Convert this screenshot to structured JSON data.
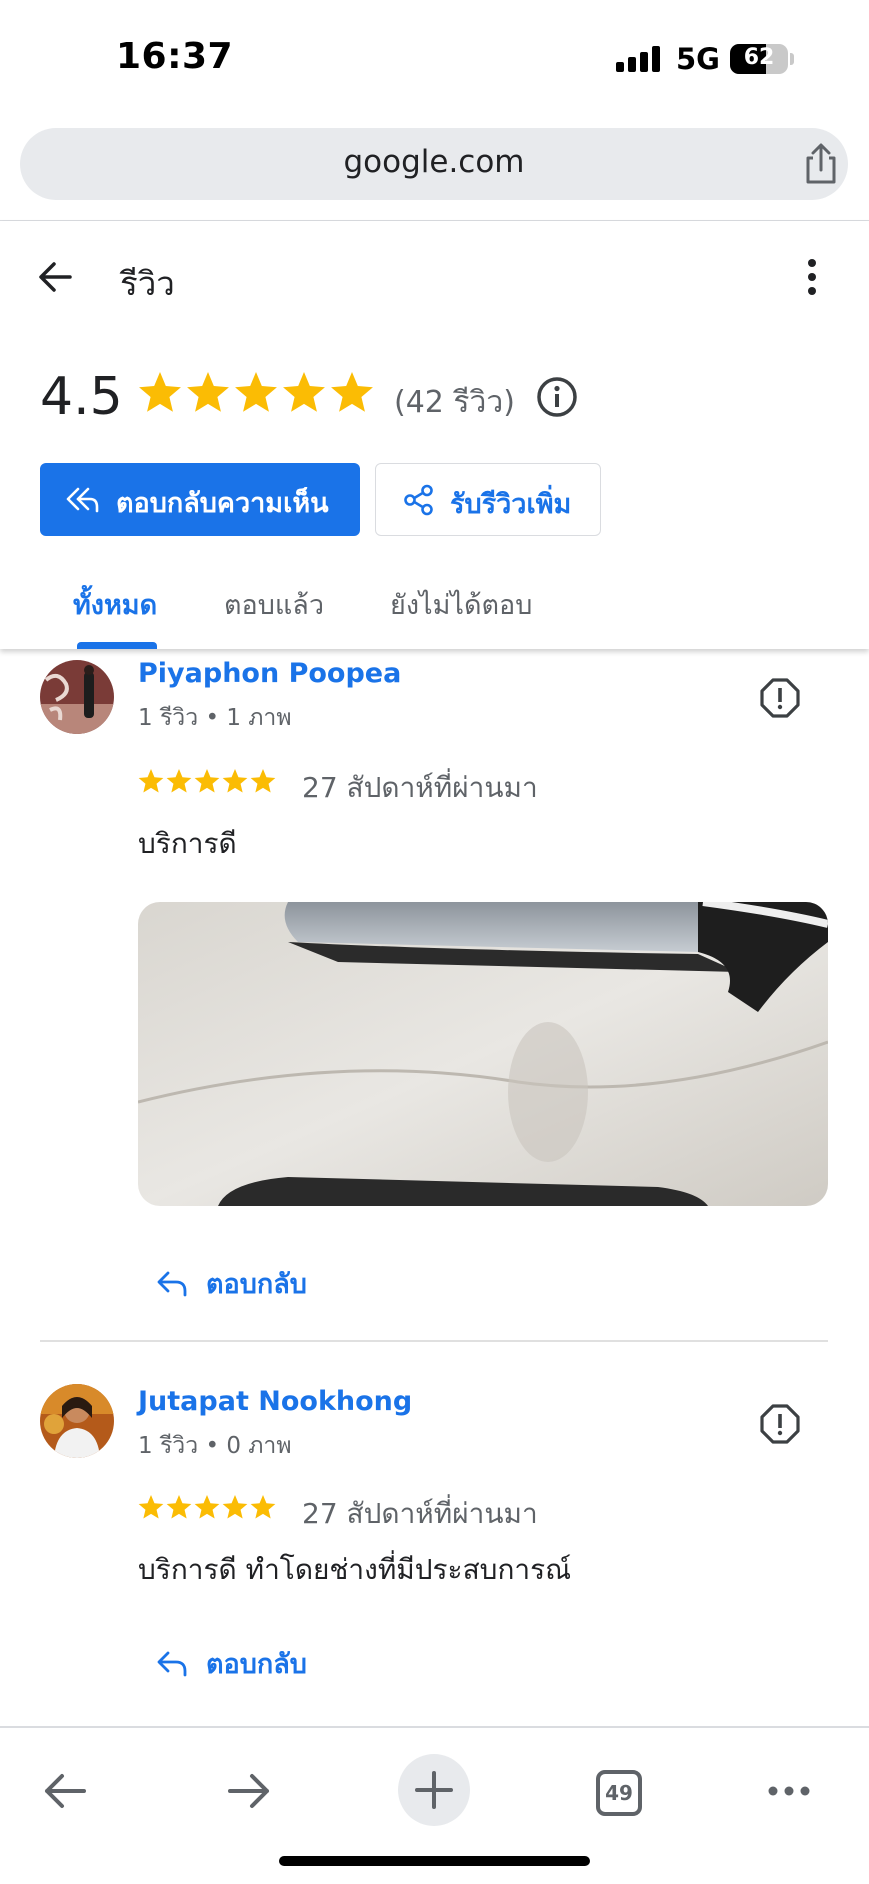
{
  "status_bar": {
    "time": "16:37",
    "network": "5G",
    "battery": "62",
    "battery_level_percent": 62
  },
  "browser": {
    "url": "google.com"
  },
  "header": {
    "title": "รีวิว",
    "rating": "4.5",
    "star_count": 5,
    "review_count": "(42 รีวิว)",
    "reply_button": "ตอบกลับความเห็น",
    "get_reviews_button": "รับรีวิวเพิ่ม",
    "tabs": [
      {
        "label": "ทั้งหมด",
        "active": true
      },
      {
        "label": "ตอบแล้ว",
        "active": false
      },
      {
        "label": "ยังไม่ได้ตอบ",
        "active": false
      }
    ]
  },
  "reviews": [
    {
      "name": "Piyaphon Poopea",
      "meta": "1 รีวิว • 1 ภาพ",
      "stars": 5,
      "date": "27 สัปดาห์ที่ผ่านมา",
      "text": "บริการดี",
      "has_photo": true,
      "reply_label": "ตอบกลับ"
    },
    {
      "name": "Jutapat Nookhong",
      "meta": "1 รีวิว • 0 ภาพ",
      "stars": 5,
      "date": "27 สัปดาห์ที่ผ่านมา",
      "text": "บริการดี ทำโดยช่างที่มีประสบการณ์",
      "has_photo": false,
      "reply_label": "ตอบกลับ"
    }
  ],
  "toolbar": {
    "tab_count": "49"
  },
  "colors": {
    "accent": "#1a73e8",
    "star": "#fbbc04",
    "text_primary": "#202124",
    "text_secondary": "#5f6368"
  }
}
